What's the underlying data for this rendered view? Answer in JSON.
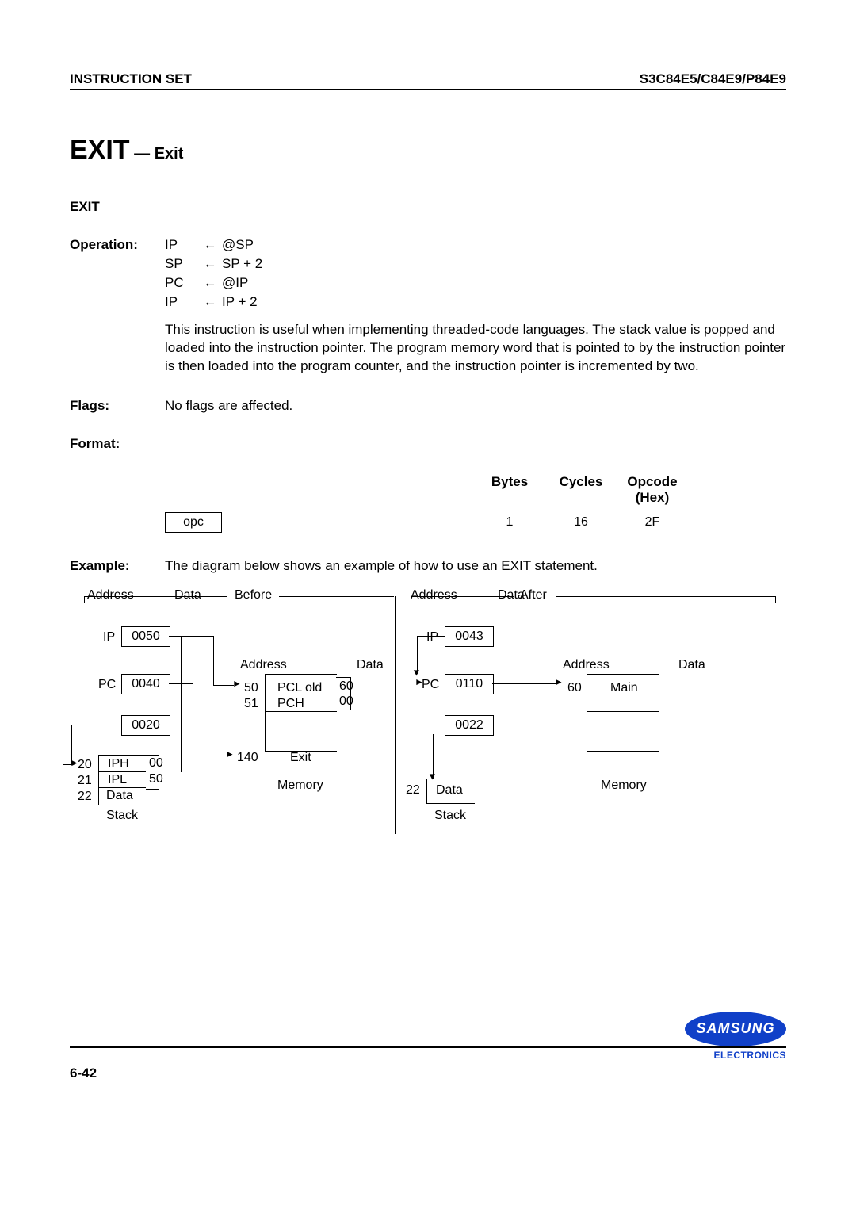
{
  "header": {
    "left": "INSTRUCTION SET",
    "right": "S3C84E5/C84E9/P84E9"
  },
  "title": {
    "main": "EXIT",
    "dash": " — ",
    "sub": "Exit"
  },
  "mnemonic": "EXIT",
  "labels": {
    "operation": "Operation:",
    "flags": "Flags:",
    "format": "Format:",
    "example": "Example:"
  },
  "operation": {
    "l1": {
      "reg": "IP",
      "arrow": "←",
      "rhs": "@SP"
    },
    "l2": {
      "reg": "SP",
      "arrow": "←",
      "rhs": "SP  +  2"
    },
    "l3": {
      "reg": "PC",
      "arrow": "←",
      "rhs": "@IP"
    },
    "l4": {
      "reg": "IP",
      "arrow": "←",
      "rhs": "IP  +  2"
    }
  },
  "description": "This instruction is useful when implementing threaded-code languages. The stack value is popped and loaded into the instruction pointer. The program memory word that is pointed to by the instruction pointer is then loaded into the program counter, and the instruction pointer is incremented by two.",
  "flags_text": "No flags are affected.",
  "format": {
    "headers": {
      "bytes": "Bytes",
      "cycles": "Cycles",
      "opcode1": "Opcode",
      "opcode2": "(Hex)"
    },
    "opc": "opc",
    "bytes": "1",
    "cycles": "16",
    "opcode": "2F"
  },
  "example_text": "The diagram below shows an example of how to use an EXIT statement.",
  "diagram": {
    "before": "Before",
    "after": "After",
    "address": "Address",
    "data": "Data",
    "ip": "IP",
    "pc": "PC",
    "stack": "Stack",
    "memory": "Memory",
    "before_vals": {
      "ip": "0050",
      "pc": "0040",
      "sp": "0020",
      "stack_a": [
        "20",
        "21",
        "22"
      ],
      "stack_d": [
        "IPH",
        "IPL",
        "Data"
      ],
      "stack_v": [
        "00",
        "50"
      ],
      "mem_a": [
        "50",
        "51",
        "140"
      ],
      "mem_d": [
        "PCL old",
        "PCH",
        "Exit"
      ],
      "mem_v": [
        "60",
        "00"
      ]
    },
    "after_vals": {
      "ip": "0043",
      "pc": "0110",
      "sp": "0022",
      "stack_a": [
        "22"
      ],
      "stack_d": [
        "Data"
      ],
      "mem_a": [
        "60"
      ],
      "mem_d": [
        "Main"
      ]
    },
    "arrow_mark": "►"
  },
  "footer": {
    "page": "6-42",
    "brand": "SAMSUNG",
    "brand_sub": "ELECTRONICS"
  }
}
